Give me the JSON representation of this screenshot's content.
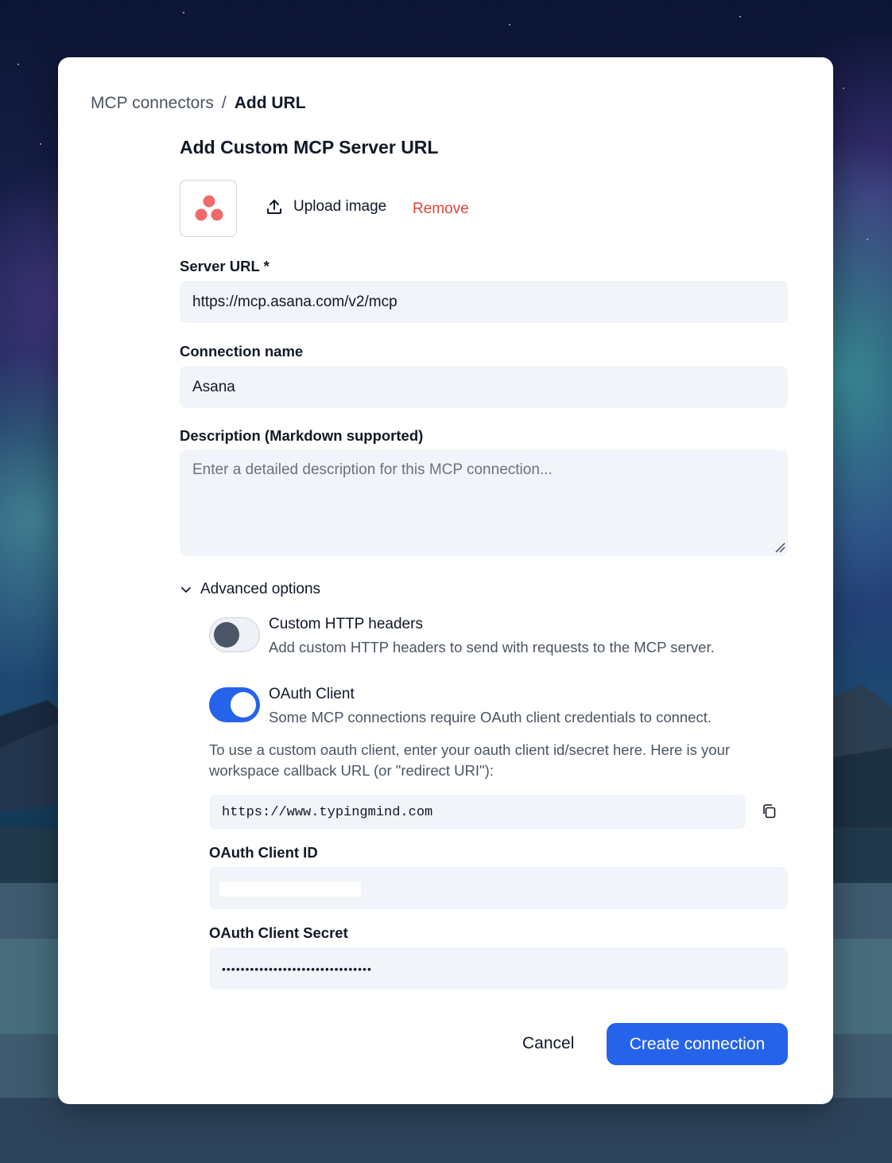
{
  "breadcrumb": {
    "parent": "MCP connectors",
    "separator": "/",
    "current": "Add URL"
  },
  "title": "Add Custom MCP Server URL",
  "image": {
    "upload_label": "Upload image",
    "remove_label": "Remove",
    "icon": "asana-logo"
  },
  "server_url": {
    "label": "Server URL *",
    "value": "https://mcp.asana.com/v2/mcp"
  },
  "connection_name": {
    "label": "Connection name",
    "value": "Asana"
  },
  "description": {
    "label": "Description (Markdown supported)",
    "placeholder": "Enter a detailed description for this MCP connection..."
  },
  "advanced": {
    "label": "Advanced options",
    "custom_headers": {
      "title": "Custom HTTP headers",
      "description": "Add custom HTTP headers to send with requests to the MCP server.",
      "enabled": false
    },
    "oauth": {
      "title": "OAuth Client",
      "description": "Some MCP connections require OAuth client credentials to connect.",
      "enabled": true,
      "info": "To use a custom oauth client, enter your oauth client id/secret here. Here is your workspace callback URL (or \"redirect URI\"):",
      "callback_url": "https://www.typingmind.com",
      "client_id_label": "OAuth Client ID",
      "client_id_value": "",
      "client_secret_label": "OAuth Client Secret",
      "client_secret_value": "••••••••••••••••••••••••••••••••"
    }
  },
  "actions": {
    "cancel": "Cancel",
    "create": "Create connection"
  },
  "colors": {
    "primary": "#2563eb",
    "danger": "#e0443a",
    "field_bg": "#f1f4f8",
    "asana_coral": "#f06a6a"
  }
}
